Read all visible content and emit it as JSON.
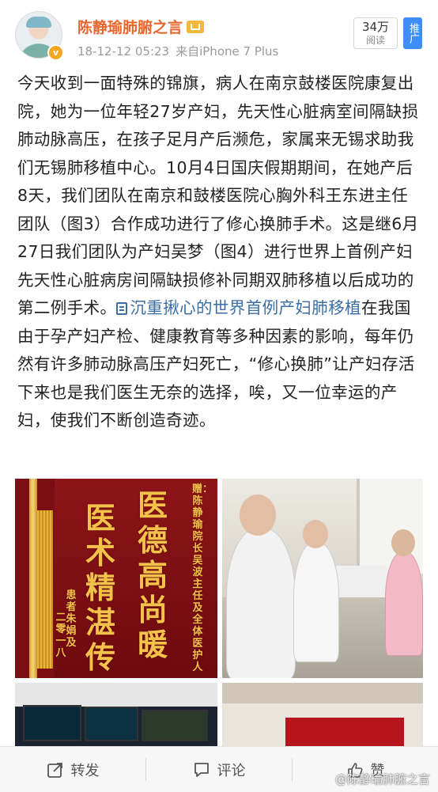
{
  "post": {
    "username": "陈静瑜肺腑之言",
    "timestamp": "18-12-12 05:23",
    "source": "来自iPhone 7 Plus",
    "read_count": "34万",
    "read_label": "阅读",
    "promote_label": "推广",
    "body_text": "今天收到一面特殊的锦旗，病人在南京鼓楼医院康复出院，她为一位年轻27岁产妇，先天性心脏病室间隔缺损肺动脉高压，在孩子足月产后濒危，家属来无锡求助我们无锡肺移植中心。10月4日国庆假期期间，在她产后8天，我们团队在南京和鼓楼医院心胸外科王东进主任团队（图3）合作成功进行了修心换肺手术。这是继6月27日我们团队为产妇吴梦（图4）进行世界上首例产妇先天性心脏病房间隔缺损修补同期双肺移植以后成功的第二例手术。",
    "link_text": "沉重揪心的世界首例产妇肺移植",
    "body_text_after": "在我国由于孕产妇产检、健康教育等多种因素的影响，每年仍然有许多肺动脉高压产妇死亡，“修心换肺”让产妇存活下来也是我们医生无奈的选择，唉，又一位幸运的产妇，使我们不断创造奇迹。"
  },
  "banner": {
    "right_column": "医德高尚暖",
    "left_column": "医术精湛传四",
    "dedication": "赠：陈静瑜院长 吴波主任及全体医护人",
    "signature": "患者朱娟及",
    "date": "二零一八"
  },
  "actions": {
    "repost": "转发",
    "comment": "评论",
    "like": "赞"
  },
  "watermark": "@陈静瑜肺腑之言",
  "colors": {
    "username": "#e8662c",
    "link": "#3a6ea5",
    "promote": "#3e8ef7"
  }
}
